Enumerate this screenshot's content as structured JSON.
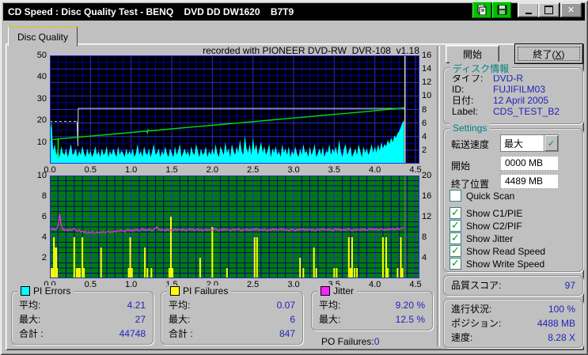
{
  "titlebar": {
    "title": "CD Speed : Disc Quality Test - BENQ    DVD DD DW1620    B7T9",
    "minimize_glyph": "_",
    "maximize_glyph": "□",
    "close_glyph": "✕"
  },
  "tab": {
    "label": "Disc Quality"
  },
  "chart_header": "recorded with PIONEER DVD-RW  DVR-108  v1.18",
  "colors": {
    "pi_errors": "#00ffff",
    "pi_failures": "#ffff00",
    "jitter": "#ff22ff",
    "write_speed": "#00dd00",
    "read_speed": "#d8d8d8",
    "grid_major": "#2a2adc",
    "grid_minor": "#0000a0",
    "chart1_bg": "#000000",
    "chart2_bg": "#007d00",
    "end_marker_top": "#d8d8d8",
    "end_marker_bottom": "#607060",
    "value_text": "#2222bb",
    "group_title": "#008080"
  },
  "chart_data": [
    {
      "type": "area",
      "name": "PI Errors / Speed",
      "title": "recorded with PIONEER DVD-RW  DVR-108  v1.18",
      "x_range": [
        0,
        4.5
      ],
      "x_ticks": [
        "0.0",
        "0.5",
        "1.0",
        "1.5",
        "2.0",
        "2.5",
        "3.0",
        "3.5",
        "4.0",
        "4.5"
      ],
      "left_axis": {
        "range": [
          0,
          50
        ],
        "ticks": [
          "50",
          "40",
          "30",
          "20",
          "10"
        ]
      },
      "right_axis": {
        "range": [
          0,
          16
        ],
        "ticks": [
          "16",
          "14",
          "12",
          "10",
          "8",
          "6",
          "4",
          "2"
        ]
      },
      "grid": "on",
      "x_step": 0.02,
      "end_marker_x": 4.37,
      "pi_errors_values": [
        13,
        20,
        6,
        9,
        4,
        7,
        3,
        8,
        5,
        4,
        7,
        3,
        6,
        9,
        4,
        5,
        7,
        3,
        6,
        4,
        8,
        5,
        3,
        7,
        4,
        6,
        3,
        5,
        8,
        4,
        6,
        3,
        7,
        4,
        5,
        8,
        3,
        6,
        4,
        7,
        5,
        3,
        8,
        4,
        6,
        5,
        3,
        7,
        4,
        6,
        4,
        7,
        3,
        5,
        9,
        4,
        6,
        3,
        8,
        5,
        4,
        7,
        3,
        6,
        9,
        4,
        5,
        7,
        3,
        6,
        4,
        8,
        5,
        3,
        7,
        5,
        3,
        8,
        4,
        6,
        9,
        3,
        5,
        7,
        4,
        6,
        3,
        8,
        5,
        4,
        9,
        6,
        3,
        7,
        4,
        5,
        8,
        3,
        6,
        4,
        7,
        4,
        9,
        5,
        3,
        8,
        6,
        4,
        10,
        5,
        7,
        3,
        9,
        6,
        4,
        8,
        5,
        11,
        6,
        4,
        13,
        7,
        5,
        9,
        4,
        12,
        6,
        9,
        4,
        7,
        10,
        5,
        8,
        4,
        6,
        9,
        3,
        7,
        5,
        8,
        4,
        6,
        3,
        9,
        5,
        7,
        4,
        8,
        3,
        6,
        4,
        8,
        5,
        3,
        7,
        4,
        9,
        5,
        6,
        3,
        8,
        4,
        6,
        9,
        3,
        5,
        7,
        4,
        8,
        3,
        6,
        5,
        9,
        4,
        7,
        5,
        8,
        4,
        11,
        6,
        3,
        7,
        9,
        4,
        6,
        8,
        3,
        5,
        7,
        4,
        9,
        6,
        3,
        8,
        5,
        7,
        4,
        6,
        9,
        5,
        8,
        5,
        9,
        6,
        10,
        7,
        9,
        8,
        11,
        9,
        12,
        10,
        13,
        12,
        14,
        15,
        17,
        19,
        20
      ],
      "write_speed_points": [
        [
          0.0,
          3.55
        ],
        [
          0.06,
          3.6
        ],
        [
          0.1,
          3.64
        ],
        [
          0.102,
          0.85
        ],
        [
          0.105,
          3.65
        ],
        [
          0.3,
          3.86
        ],
        [
          0.6,
          4.18
        ],
        [
          0.9,
          4.5
        ],
        [
          1.19,
          4.81
        ],
        [
          1.2,
          4.55
        ],
        [
          1.21,
          5.0
        ],
        [
          1.22,
          4.84
        ],
        [
          1.5,
          5.14
        ],
        [
          1.8,
          5.46
        ],
        [
          2.1,
          5.78
        ],
        [
          2.4,
          6.1
        ],
        [
          2.7,
          6.42
        ],
        [
          3.0,
          6.74
        ],
        [
          3.3,
          7.06
        ],
        [
          3.6,
          7.38
        ],
        [
          3.9,
          7.7
        ],
        [
          4.1,
          7.95
        ],
        [
          4.25,
          8.12
        ],
        [
          4.37,
          8.28
        ]
      ],
      "read_speed_dashed": [
        [
          0,
          6.24
        ],
        [
          0.335,
          6.24
        ]
      ],
      "read_speed_solid": [
        [
          0.335,
          6.24
        ],
        [
          0.345,
          2.6
        ],
        [
          0.35,
          8.16
        ],
        [
          4.37,
          8.16
        ]
      ]
    },
    {
      "type": "line+spikes",
      "name": "PI Failures / Jitter",
      "x_range": [
        0,
        4.5
      ],
      "x_ticks": [
        "0.0",
        "0.5",
        "1.0",
        "1.5",
        "2.0",
        "2.5",
        "3.0",
        "3.5",
        "4.0",
        "4.5"
      ],
      "left_axis": {
        "range": [
          0,
          10
        ],
        "ticks": [
          "10",
          "8",
          "6",
          "4",
          "2"
        ]
      },
      "right_axis": {
        "range": [
          0,
          20
        ],
        "ticks": [
          "20",
          "16",
          "12",
          "8",
          "4"
        ]
      },
      "grid": "on",
      "x_step": 0.02,
      "end_marker_x": 4.37,
      "jitter_percent": [
        9.7,
        9.5,
        9.8,
        9.4,
        9.6,
        10.1,
        12.5,
        10.3,
        9.6,
        9.3,
        9.5,
        9.2,
        9.6,
        9.3,
        9.5,
        9.7,
        9.3,
        9.1,
        9.4,
        9.0,
        9.2,
        8.9,
        9.1,
        8.8,
        9.0,
        8.8,
        9.1,
        8.9,
        8.8,
        9.0,
        8.8,
        9.0,
        8.9,
        9.1,
        8.8,
        9.0,
        9.2,
        8.9,
        9.1,
        9.0,
        9.2,
        9.0,
        9.3,
        9.1,
        9.4,
        9.2,
        9.0,
        9.3,
        9.5,
        9.2,
        9.4,
        9.1,
        9.5,
        9.3,
        9.6,
        9.2,
        9.4,
        9.7,
        9.3,
        9.5,
        9.3,
        9.6,
        9.4,
        9.2,
        9.5,
        9.8,
        10.0,
        9.6,
        9.3,
        9.5,
        9.4,
        9.2,
        9.6,
        9.3,
        9.5,
        9.2,
        9.4,
        9.6,
        9.3,
        9.5,
        9.5,
        9.3,
        9.6,
        9.4,
        9.2,
        9.5,
        9.7,
        9.4,
        9.6,
        9.3,
        9.4,
        9.6,
        9.3,
        9.5,
        9.2,
        9.4,
        9.6,
        9.3,
        9.5,
        9.4,
        9.3,
        9.5,
        9.7,
        9.4,
        9.2,
        9.5,
        9.3,
        9.6,
        9.4,
        9.5,
        9.5,
        9.2,
        9.4,
        9.6,
        9.3,
        9.5,
        9.7,
        9.4,
        9.2,
        9.5,
        9.4,
        9.6,
        9.3,
        9.5,
        9.3,
        9.6,
        9.4,
        9.7,
        9.5,
        9.3,
        9.5,
        9.3,
        9.6,
        9.4,
        9.2,
        9.5,
        9.3,
        9.6,
        9.4,
        9.6,
        9.3,
        9.5,
        9.7,
        9.4,
        9.6,
        9.3,
        9.5,
        9.2,
        9.4,
        9.6,
        9.4,
        9.2,
        9.5,
        9.3,
        9.6,
        9.4,
        9.7,
        9.3,
        9.5,
        9.4,
        9.6,
        9.3,
        9.5,
        9.2,
        9.4,
        9.6,
        9.3,
        9.5,
        9.7,
        9.4,
        9.5,
        9.3,
        9.6,
        9.4,
        9.2,
        9.5,
        9.7,
        9.4,
        9.6,
        9.3,
        9.4,
        9.6,
        9.3,
        9.5,
        9.7,
        9.4,
        9.2,
        9.5,
        9.3,
        9.6,
        9.5,
        9.3,
        9.6,
        9.4,
        9.6,
        9.3,
        9.5,
        9.7,
        9.4,
        9.6,
        9.4,
        9.6,
        9.3,
        9.5,
        9.7,
        9.5,
        9.3,
        9.6,
        9.4,
        9.7,
        9.5,
        9.7,
        9.4,
        9.6,
        9.8,
        9.5,
        9.7,
        9.9,
        9.8
      ],
      "pi_failures_spikes": [
        [
          0.02,
          1
        ],
        [
          0.04,
          1
        ],
        [
          0.05,
          4
        ],
        [
          0.07,
          3
        ],
        [
          0.08,
          3
        ],
        [
          0.09,
          1
        ],
        [
          0.3,
          4
        ],
        [
          0.33,
          1
        ],
        [
          0.35,
          1
        ],
        [
          0.37,
          1
        ],
        [
          0.4,
          4
        ],
        [
          0.42,
          1
        ],
        [
          0.63,
          3
        ],
        [
          0.97,
          1
        ],
        [
          0.99,
          4
        ],
        [
          1.01,
          1
        ],
        [
          1.17,
          3
        ],
        [
          1.2,
          1
        ],
        [
          1.25,
          1
        ],
        [
          1.47,
          1
        ],
        [
          1.49,
          6
        ],
        [
          1.51,
          1
        ],
        [
          1.85,
          2
        ],
        [
          2.0,
          5
        ],
        [
          2.18,
          1
        ],
        [
          2.52,
          4
        ],
        [
          2.55,
          4
        ],
        [
          3.08,
          2
        ],
        [
          3.12,
          1
        ],
        [
          3.25,
          3
        ],
        [
          3.28,
          1
        ],
        [
          3.5,
          1
        ],
        [
          3.53,
          1
        ],
        [
          3.68,
          4
        ],
        [
          3.7,
          1
        ],
        [
          3.72,
          4
        ],
        [
          3.75,
          1
        ],
        [
          3.78,
          1
        ],
        [
          4.1,
          4
        ],
        [
          4.14,
          4
        ],
        [
          4.16,
          1
        ],
        [
          4.28,
          1
        ],
        [
          4.32,
          4
        ],
        [
          4.34,
          1
        ]
      ]
    }
  ],
  "legend": {
    "pi_errors": {
      "title": "PI Errors",
      "color": "#00ffff",
      "rows": [
        {
          "label": "平均:",
          "value": "4.21"
        },
        {
          "label": "最大:",
          "value": "27"
        },
        {
          "label": "合計 :",
          "value": "44748"
        }
      ]
    },
    "pi_failures": {
      "title": "PI Failures",
      "color": "#ffff00",
      "rows": [
        {
          "label": "平均:",
          "value": "0.07"
        },
        {
          "label": "最大:",
          "value": "6"
        },
        {
          "label": "合計 :",
          "value": "847"
        }
      ]
    },
    "jitter": {
      "title": "Jitter",
      "color": "#ff22ff",
      "rows": [
        {
          "label": "平均:",
          "value": "9.20 %"
        },
        {
          "label": "最大:",
          "value": "12.5 %"
        }
      ]
    },
    "po_rows": [
      {
        "label": "PO Failures:",
        "value": "0"
      }
    ]
  },
  "right_panel": {
    "start_button": "開始",
    "exit_button": {
      "pre": "終了(",
      "key": "X",
      "post": ")"
    },
    "disc_info": {
      "title": "ディスク情報",
      "rows": [
        {
          "label": "タイプ:",
          "value": "DVD-R"
        },
        {
          "label": "ID:",
          "value": "FUJIFILM03"
        },
        {
          "label": "日付:",
          "value": "12 April 2005"
        },
        {
          "label": "Label:",
          "value": "CDS_TEST_B2"
        }
      ]
    },
    "settings": {
      "title": "Settings",
      "speed_label": "転送速度",
      "speed_value": "最大",
      "start_label": "開始",
      "start_value": "0000 MB",
      "end_label": "終了位置",
      "end_value": "4489 MB",
      "checkboxes": [
        {
          "label": "Quick Scan",
          "checked": false
        },
        {
          "label": "Show C1/PIE",
          "checked": true
        },
        {
          "label": "Show C2/PIF",
          "checked": true
        },
        {
          "label": "Show Jitter",
          "checked": true
        },
        {
          "label": "Show Read Speed",
          "checked": true
        },
        {
          "label": "Show Write Speed",
          "checked": true
        }
      ]
    },
    "score_rows": [
      {
        "label": "品質スコア:",
        "value": "97"
      }
    ],
    "progress_rows": [
      {
        "label": "進行状況:",
        "value": "100 %"
      },
      {
        "label": "ポジション:",
        "value": "4488 MB"
      },
      {
        "label": "速度:",
        "value": "8.28 X"
      }
    ]
  }
}
